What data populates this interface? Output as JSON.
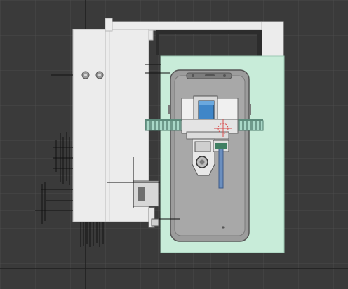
{
  "viewport": {
    "kind": "cad-top-view",
    "background_color": "#3a3a3a",
    "grid_color": "#4b4b4b",
    "axis_color": "#1e1e1e"
  },
  "palette": {
    "housing": "#ececec",
    "housing_edge": "#b9b9b9",
    "fixture_plate": "#c8ecd9",
    "phone_body": "#9c9c9c",
    "phone_screen": "#a8a8a8",
    "rail": "#8fbfb1",
    "probe": "#6b8fbf",
    "cursor": "#d84a4a",
    "camera_blue": "#3f86c8",
    "wire": "#111111"
  },
  "objects": [
    {
      "name": "vertical-guide-housing",
      "type": "part"
    },
    {
      "name": "top-frame-bar",
      "type": "part"
    },
    {
      "name": "right-frame-bar",
      "type": "part"
    },
    {
      "name": "phone-fixture-plate",
      "type": "part"
    },
    {
      "name": "smartphone",
      "type": "part"
    },
    {
      "name": "camera-carriage",
      "type": "part"
    },
    {
      "name": "gear-rail",
      "type": "part"
    },
    {
      "name": "touch-probe",
      "type": "part"
    },
    {
      "name": "clamp-bracket",
      "type": "part"
    }
  ]
}
